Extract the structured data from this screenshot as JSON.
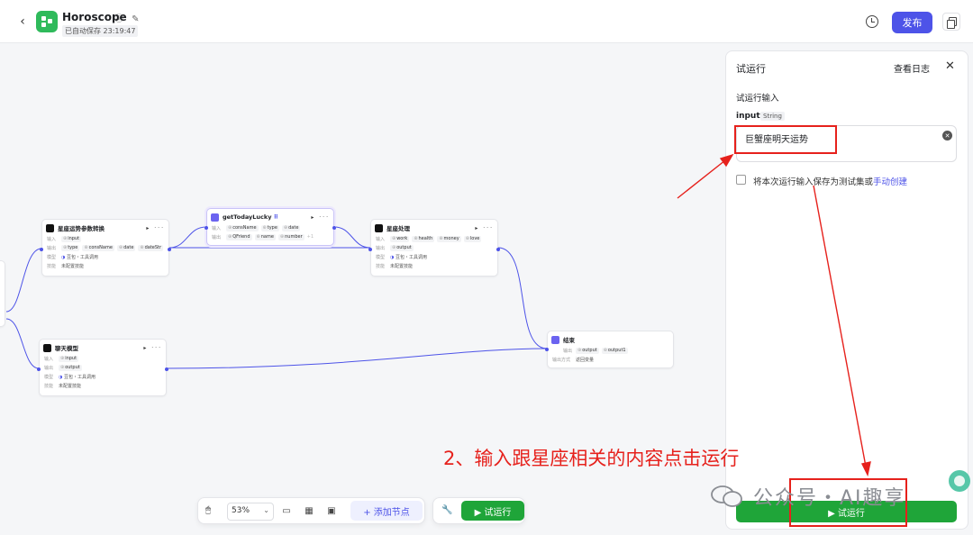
{
  "header": {
    "back_icon": "‹",
    "title": "Horoscope",
    "title_icons": "ⓘ ✎",
    "saved_status": "已自动保存 23:19:47",
    "publish_label": "发布"
  },
  "nodes": {
    "convert": {
      "title": "星座运势参数转换",
      "actions": "▸ ···",
      "input_label": "输入",
      "input_tags": [
        "input"
      ],
      "output_label": "输出",
      "output_tags": [
        "type",
        "consName",
        "date",
        "dateStr"
      ],
      "model_label": "模型",
      "model": "豆包・工具调用",
      "skill_label": "技能",
      "skill": "未配置技能"
    },
    "lucky": {
      "title": "getTodayLucky",
      "title_suffix": "⠿",
      "actions": "▸ ···",
      "input_label": "输入",
      "input_tags": [
        "consName",
        "type",
        "date"
      ],
      "output_label": "输出",
      "output_tags": [
        "QFriend",
        "name",
        "number"
      ],
      "output_more": "+1"
    },
    "process": {
      "title": "星座处理",
      "actions": "▸ ···",
      "input_label": "输入",
      "input_tags": [
        "work",
        "health",
        "money",
        "love"
      ],
      "output_label": "输出",
      "output_tags": [
        "output"
      ],
      "model_label": "模型",
      "model": "豆包・工具调用",
      "skill_label": "技能",
      "skill": "未配置技能"
    },
    "chat": {
      "title": "聊天模型",
      "actions": "▸ ···",
      "input_label": "输入",
      "input_tags": [
        "input"
      ],
      "output_label": "输出",
      "output_tags": [
        "output"
      ],
      "model_label": "模型",
      "model": "豆包・工具调用",
      "skill_label": "技能",
      "skill": "未配置技能"
    },
    "end": {
      "title": "结束",
      "output_label": "输出",
      "output_tags": [
        "output",
        "output1"
      ],
      "mode_label": "输出方式",
      "mode": "返回变量"
    }
  },
  "toolbar": {
    "mouse_icon": "🖱",
    "zoom": "53%",
    "zoom_chevron": "⌄",
    "comment_icon": "▭",
    "layout_icon": "▦",
    "minimap_icon": "▣",
    "add_node_label": "+ 添加节点",
    "wrench_icon": "🔧",
    "run_label": "▶ 试运行"
  },
  "panel": {
    "title": "试运行",
    "log_label": "查看日志",
    "close_icon": "✕",
    "section_title": "试运行输入",
    "field_name": "input",
    "field_type": "String",
    "input_value": "巨蟹座明天运势",
    "clear_icon": "✕",
    "checkbox_label": "将本次运行输入保存为测试集或",
    "checkbox_link": "手动创建",
    "run_label": "▶ 试运行"
  },
  "annotation": {
    "text": "2、输入跟星座相关的内容点击运行",
    "color": "#e6211c"
  },
  "watermark": {
    "text": "公众号・AI趣享"
  },
  "colors": {
    "brand": "#4d53e8",
    "run_green": "#1fa539",
    "logo_green": "#2fba5b",
    "edge": "#4d53e8"
  }
}
